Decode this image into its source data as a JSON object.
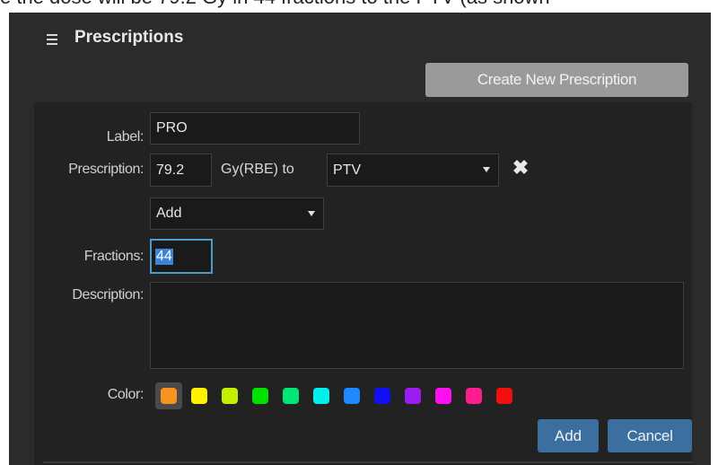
{
  "top_caption": "e the dose will be 79.2 Gy in 44 fractions to the PTV (as shown",
  "panel": {
    "title": "Prescriptions",
    "menu_icon": "hamburger-menu-icon"
  },
  "create_button_label": "Create New Prescription",
  "form": {
    "label_label": "Label:",
    "label_value": "PRO",
    "prescription_label": "Prescription:",
    "dose_value": "79.2",
    "dose_unit_text": "Gy(RBE) to",
    "target_value": "PTV",
    "remove_icon": "close-x-icon",
    "operation_value": "Add",
    "fractions_label": "Fractions:",
    "fractions_value": "44",
    "description_label": "Description:",
    "description_value": "",
    "color_label": "Color:",
    "colors": [
      "#f7941d",
      "#fff200",
      "#c4f000",
      "#00e000",
      "#00e676",
      "#00f0f0",
      "#1e88ff",
      "#1010f0",
      "#9a1cf0",
      "#ff10f0",
      "#ff1c8c",
      "#f01010"
    ],
    "selected_color_index": 0
  },
  "buttons": {
    "add_label": "Add",
    "cancel_label": "Cancel"
  }
}
